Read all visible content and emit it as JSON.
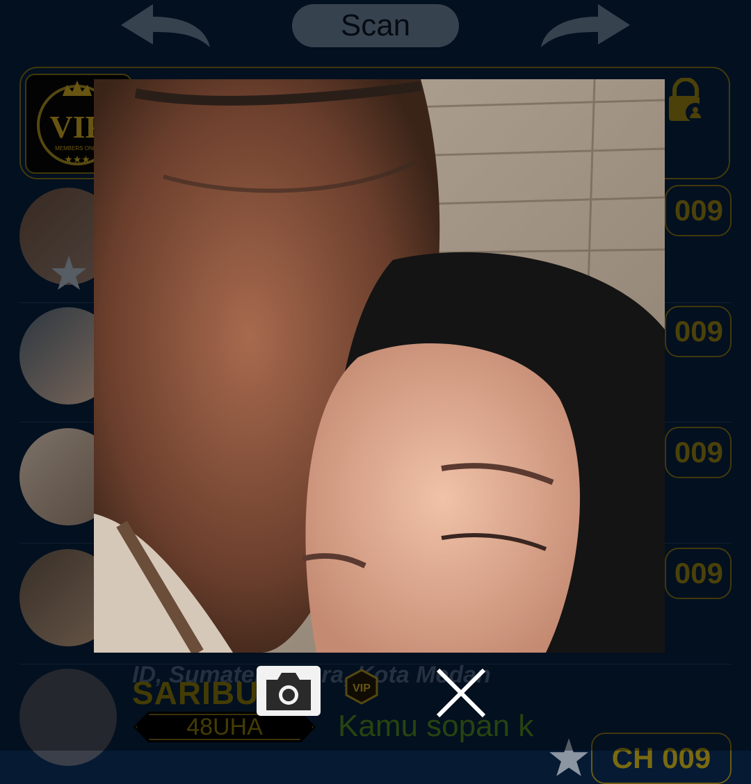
{
  "header": {
    "scan_label": "Scan",
    "back_icon": "undo-arrow-icon",
    "forward_icon": "redo-arrow-icon"
  },
  "vip_card": {
    "logo_text": "VIP",
    "logo_subtext": "MEMBERS ONLY",
    "lock_icon": "lock-person-icon"
  },
  "list_rows": [
    {
      "channel_label": "009",
      "has_star": true
    },
    {
      "channel_label": "009",
      "has_star": false
    },
    {
      "channel_label": "009",
      "has_star": false
    },
    {
      "channel_label": "009",
      "has_star": false
    }
  ],
  "last_row": {
    "location": "ID, Sumatera Utara, Kota Medan",
    "name": "SARIBU  CA",
    "id_tag": "48UHA",
    "message": "Kamu sopan k",
    "channel_label": "CH 009",
    "vip_badge_text": "VIP"
  },
  "overlay": {
    "camera_icon": "camera-icon",
    "close_icon": "close-x-icon"
  },
  "colors": {
    "background": "#061a34",
    "gold": "#6b5c12",
    "pill": "#5a6b80"
  }
}
